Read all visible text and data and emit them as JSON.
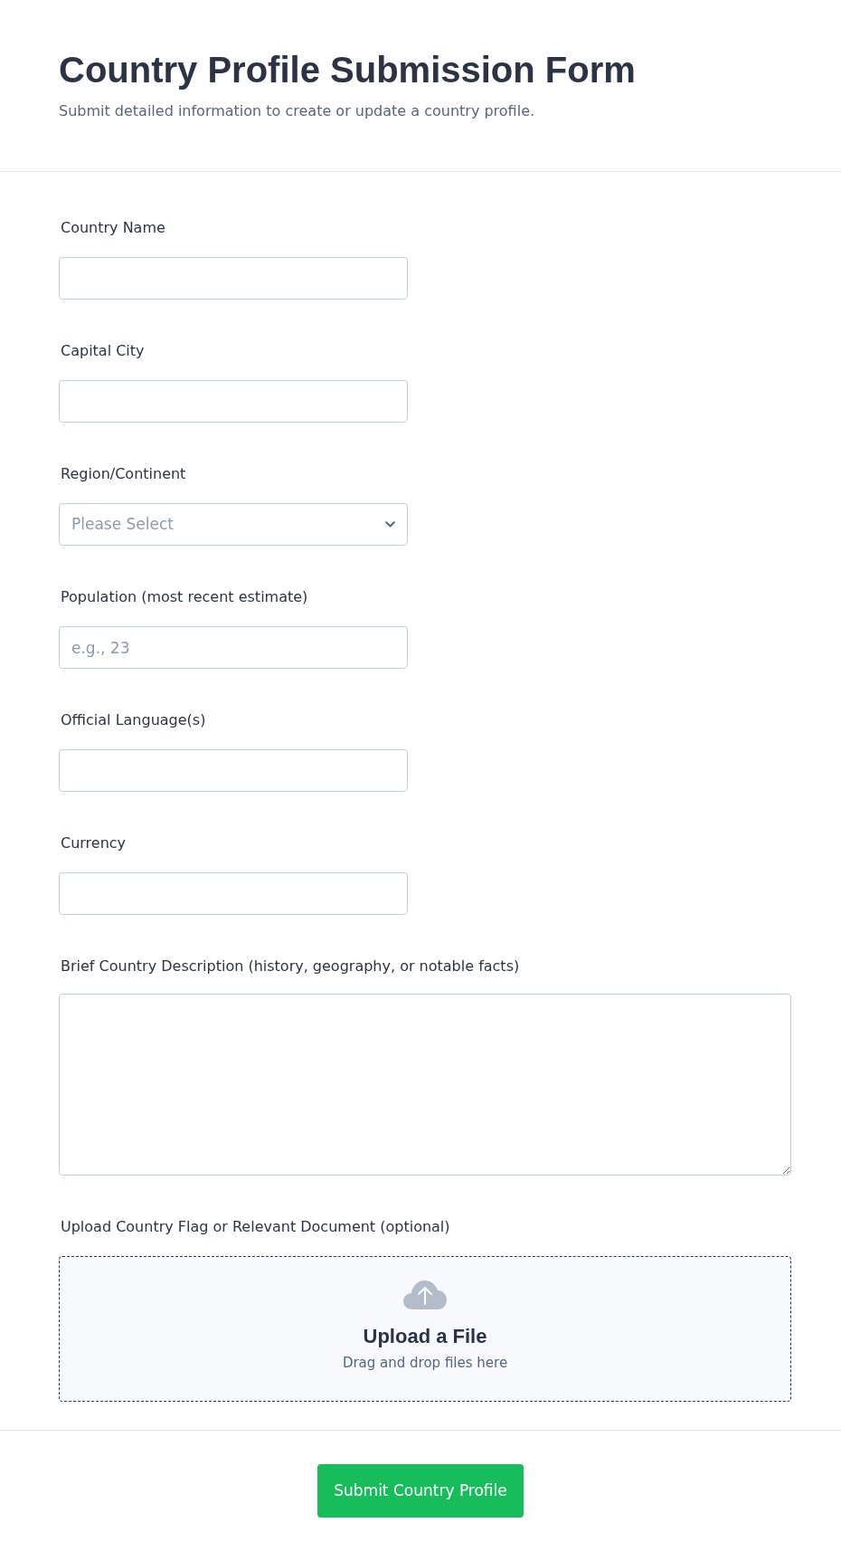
{
  "header": {
    "title": "Country Profile Submission Form",
    "subtitle": "Submit detailed information to create or update a country profile."
  },
  "fields": [
    {
      "kind": "text",
      "label": "Country Name"
    },
    {
      "kind": "text",
      "label": "Capital City"
    },
    {
      "kind": "select",
      "label": "Region/Continent",
      "placeholder": "Please Select"
    },
    {
      "kind": "text",
      "label": "Population (most recent estimate)",
      "placeholder": "e.g., 23"
    },
    {
      "kind": "text",
      "label": "Official Language(s)"
    },
    {
      "kind": "text",
      "label": "Currency"
    },
    {
      "kind": "textarea",
      "label": "Brief Country Description (history, geography, or notable facts)"
    },
    {
      "kind": "upload",
      "label": "Upload Country Flag or Relevant Document (optional)",
      "title": "Upload a File",
      "hint": "Drag and drop files here"
    }
  ],
  "submit_button": "Submit Country Profile"
}
